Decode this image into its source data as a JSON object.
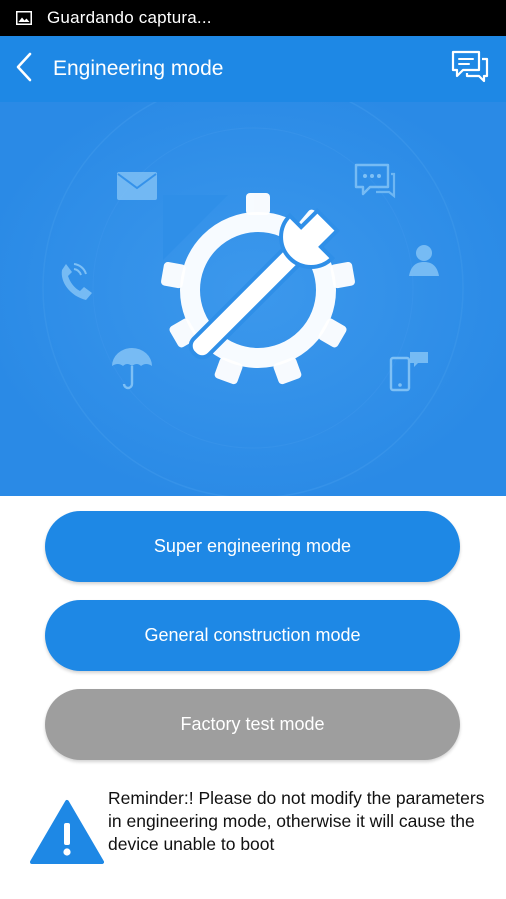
{
  "status_bar": {
    "notification_icon": "image-icon",
    "text": "Guardando captura..."
  },
  "app_bar": {
    "back_icon": "chevron-left-icon",
    "title": "Engineering mode",
    "action_icon": "chat-bubbles-icon"
  },
  "hero": {
    "center_icon": "wrench-gear-icon",
    "orbit_icons": [
      "envelope-icon",
      "chat-bubble-icon",
      "person-icon",
      "phone-icon",
      "umbrella-icon",
      "mobile-message-icon"
    ]
  },
  "buttons": {
    "super": "Super engineering mode",
    "general": "General construction mode",
    "factory": "Factory test mode"
  },
  "reminder": {
    "icon": "warning-triangle-icon",
    "text": "Reminder:! Please do not modify the parameters in engineering mode, otherwise it will cause the device unable to boot"
  },
  "colors": {
    "primary": "#1e88e5",
    "hero_bg": "#2a8ae6",
    "disabled": "#9e9e9e",
    "status_bar": "#000000"
  }
}
